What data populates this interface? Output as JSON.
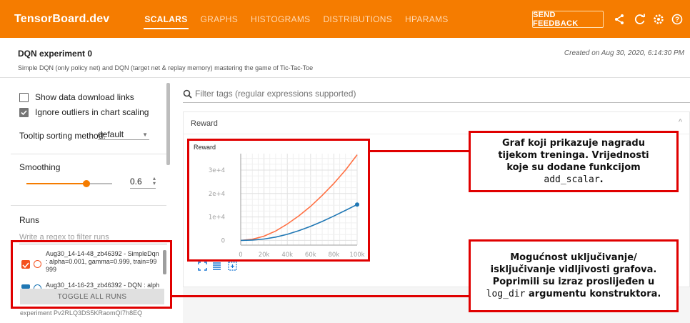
{
  "app": {
    "brand": "TensorBoard.dev",
    "tabs": [
      {
        "label": "SCALARS",
        "active": true
      },
      {
        "label": "GRAPHS",
        "active": false
      },
      {
        "label": "HISTOGRAMS",
        "active": false
      },
      {
        "label": "DISTRIBUTIONS",
        "active": false
      },
      {
        "label": "HPARAMS",
        "active": false
      }
    ],
    "feedback_label": "SEND FEEDBACK",
    "icons": [
      "share-icon",
      "refresh-icon",
      "settings-icon",
      "help-icon"
    ],
    "accent_color": "#f57c00"
  },
  "experiment": {
    "title": "DQN experiment 0",
    "description": "Simple DQN (only policy net) and DQN (target net & replay memory) mastering the game of Tic-Tac-Toe",
    "created": "Created on Aug 30, 2020, 6:14:30 PM",
    "id_text": "experiment Pv2RLQ3DS5KRaomQI7h8EQ"
  },
  "sidebar": {
    "show_download_label": "Show data download links",
    "show_download_checked": false,
    "ignore_outliers_label": "Ignore outliers in chart scaling",
    "ignore_outliers_checked": true,
    "tooltip_label": "Tooltip sorting method:",
    "tooltip_value": "default",
    "smoothing_label": "Smoothing",
    "smoothing_value": "0.6",
    "runs_label": "Runs",
    "runs_filter_placeholder": "Write a regex to filter runs",
    "runs": [
      {
        "line1": "Aug30_14-14-48_zb46392 - SimpleDqn",
        "line2": ": alpha=0.001, gamma=0.999, train=99",
        "line3": "999",
        "color": "#f4511e",
        "checked": true
      },
      {
        "line1": "Aug30_14-16-23_zb46392 - DQN : alph",
        "color": "#1f77b4",
        "checked": true
      }
    ],
    "toggle_all_label": "TOGGLE ALL RUNS"
  },
  "main": {
    "filter_placeholder": "Filter tags (regular expressions supported)",
    "card_title": "Reward",
    "chart_title": "Reward"
  },
  "chart_data": {
    "type": "line",
    "title": "Reward",
    "xlabel": "",
    "ylabel": "",
    "x_ticks": [
      "0",
      "20k",
      "40k",
      "60k",
      "80k",
      "100k"
    ],
    "y_ticks": [
      "0",
      "1e+4",
      "2e+4",
      "3e+4"
    ],
    "xlim": [
      0,
      100000
    ],
    "ylim": [
      -2000,
      37000
    ],
    "grid": true,
    "series": [
      {
        "color": "#ff7043",
        "x": [
          0,
          10000,
          20000,
          30000,
          40000,
          50000,
          60000,
          70000,
          80000,
          90000,
          100000
        ],
        "y": [
          0,
          500,
          1800,
          4000,
          7000,
          10500,
          14500,
          19200,
          24300,
          30000,
          36500
        ]
      },
      {
        "color": "#1f77b4",
        "x": [
          0,
          10000,
          20000,
          30000,
          40000,
          50000,
          60000,
          70000,
          80000,
          90000,
          100000
        ],
        "y": [
          0,
          150,
          600,
          1400,
          2600,
          4200,
          6000,
          8100,
          10400,
          12800,
          15300
        ]
      }
    ]
  },
  "annotations": {
    "callout_chart": {
      "line1": "Graf koji prikazuje nagradu",
      "line2": "tijekom treninga. Vrijednosti",
      "line3": "koje su dodane funkcijom",
      "code": "add_scalar",
      "tail": "."
    },
    "callout_runs": {
      "line1": "Mogućnost uključivanje/",
      "line2": "isključivanje vidljivosti grafova.",
      "line3": "Poprimili su izraz proslijeđen u",
      "code": "log_dir",
      "tail": " argumentu konstruktora."
    },
    "highlight_color": "#e00000"
  }
}
